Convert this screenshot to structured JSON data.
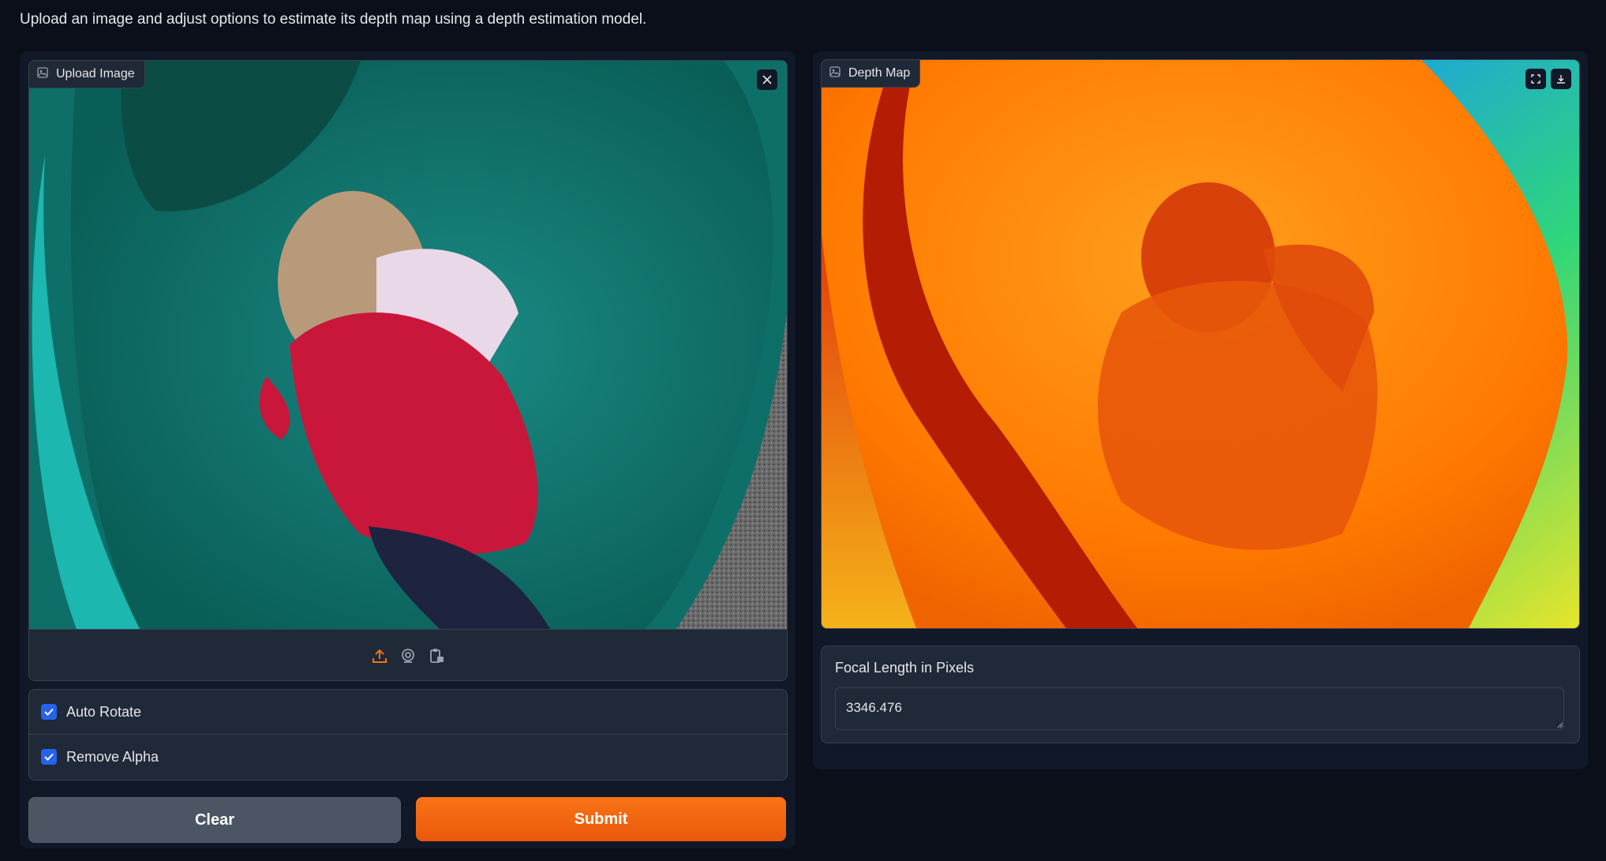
{
  "description": "Upload an image and adjust options to estimate its depth map using a depth estimation model.",
  "upload": {
    "label": "Upload Image",
    "icons": [
      "image-icon",
      "close-icon",
      "upload-icon",
      "webcam-icon",
      "clipboard-icon"
    ]
  },
  "options": {
    "auto_rotate": {
      "label": "Auto Rotate",
      "checked": true
    },
    "remove_alpha": {
      "label": "Remove Alpha",
      "checked": true
    }
  },
  "buttons": {
    "clear": "Clear",
    "submit": "Submit"
  },
  "depth_map": {
    "label": "Depth Map",
    "icons": [
      "image-icon",
      "fullscreen-icon",
      "download-icon"
    ]
  },
  "focal": {
    "label": "Focal Length in Pixels",
    "value": "3346.476"
  },
  "colors": {
    "accent": "#f97316",
    "checkbox": "#2563eb",
    "background": "#0b0f19",
    "panel": "#1f2937"
  }
}
